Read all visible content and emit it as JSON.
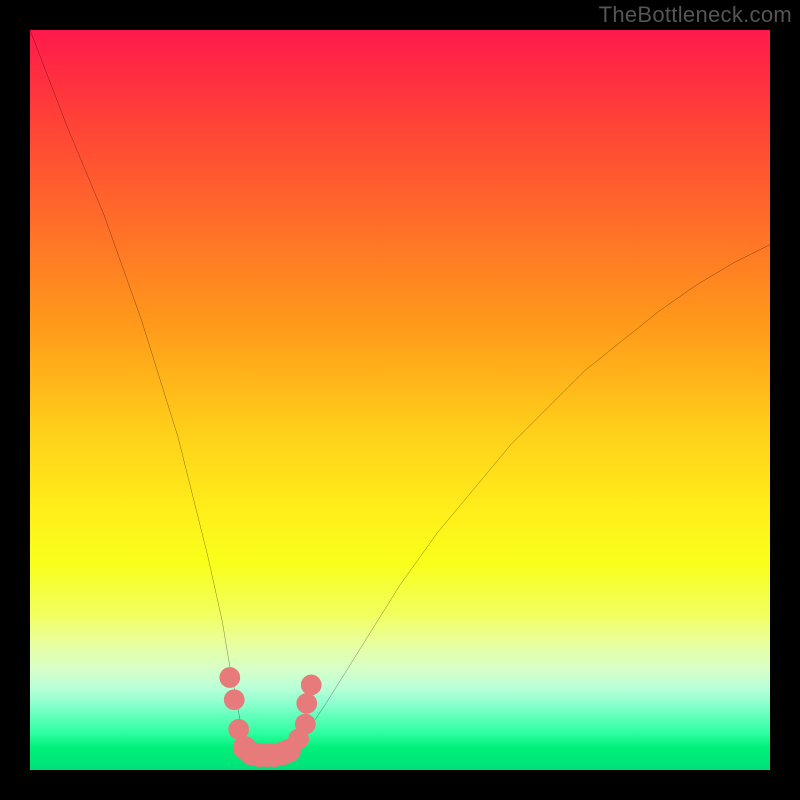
{
  "watermark": {
    "text": "TheBottleneck.com"
  },
  "chart_data": {
    "type": "line",
    "title": "",
    "xlabel": "",
    "ylabel": "",
    "xlim": [
      0,
      100
    ],
    "ylim": [
      0,
      100
    ],
    "legend": false,
    "grid": false,
    "background_gradient": {
      "direction": "vertical",
      "stops": [
        {
          "pos": 0,
          "color": "#ff1a4d"
        },
        {
          "pos": 0.25,
          "color": "#ff9a1a"
        },
        {
          "pos": 0.55,
          "color": "#ffd21a"
        },
        {
          "pos": 0.75,
          "color": "#f1ff60"
        },
        {
          "pos": 0.9,
          "color": "#8dffcf"
        },
        {
          "pos": 1.0,
          "color": "#00e07a"
        }
      ]
    },
    "series": [
      {
        "name": "bottleneck-curve",
        "color": "#000000",
        "x": [
          0,
          5,
          10,
          15,
          20,
          22,
          24,
          26,
          27,
          28,
          28.5,
          29,
          30,
          31,
          32,
          33,
          34,
          35,
          36,
          38,
          40,
          45,
          50,
          55,
          60,
          65,
          70,
          75,
          80,
          85,
          90,
          95,
          100
        ],
        "y": [
          100,
          87,
          75,
          61,
          45,
          37,
          29,
          20,
          14,
          9,
          6,
          4,
          2.5,
          2,
          2,
          2,
          2,
          2.5,
          3.5,
          6,
          9,
          17,
          25,
          32,
          38,
          44,
          49,
          54,
          58,
          62,
          65.5,
          68.5,
          71
        ]
      }
    ],
    "markers": [
      {
        "x": 27.0,
        "y": 12.5,
        "color": "#e77a7a",
        "r": 1.4
      },
      {
        "x": 27.6,
        "y": 9.5,
        "color": "#e77a7a",
        "r": 1.4
      },
      {
        "x": 28.2,
        "y": 5.5,
        "color": "#e77a7a",
        "r": 1.4
      },
      {
        "x": 29.0,
        "y": 3.0,
        "color": "#e77a7a",
        "r": 1.6
      },
      {
        "x": 30.0,
        "y": 2.2,
        "color": "#e77a7a",
        "r": 1.6
      },
      {
        "x": 31.0,
        "y": 2.0,
        "color": "#e77a7a",
        "r": 1.6
      },
      {
        "x": 32.0,
        "y": 2.0,
        "color": "#e77a7a",
        "r": 1.6
      },
      {
        "x": 33.0,
        "y": 2.0,
        "color": "#e77a7a",
        "r": 1.6
      },
      {
        "x": 34.0,
        "y": 2.2,
        "color": "#e77a7a",
        "r": 1.6
      },
      {
        "x": 35.0,
        "y": 2.6,
        "color": "#e77a7a",
        "r": 1.6
      },
      {
        "x": 36.3,
        "y": 4.2,
        "color": "#e77a7a",
        "r": 1.4
      },
      {
        "x": 37.2,
        "y": 6.2,
        "color": "#e77a7a",
        "r": 1.4
      },
      {
        "x": 37.4,
        "y": 9.0,
        "color": "#e77a7a",
        "r": 1.4
      },
      {
        "x": 38.0,
        "y": 11.5,
        "color": "#e77a7a",
        "r": 1.4
      }
    ]
  }
}
